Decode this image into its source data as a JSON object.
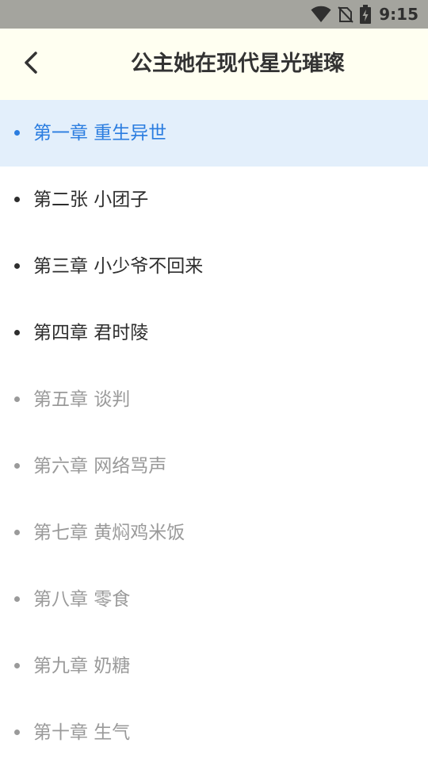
{
  "status_bar": {
    "time": "9:15",
    "icons": [
      "wifi-icon",
      "no-sim-icon",
      "battery-charging-icon"
    ]
  },
  "header": {
    "back_icon": "chevron-left-icon",
    "title": "公主她在现代星光璀璨"
  },
  "colors": {
    "active": "#2b7de0",
    "read": "#2e2e2e",
    "locked": "#9a9a9a",
    "active_bg": "#e3effb",
    "header_bg": "#fffff1"
  },
  "chapters": [
    {
      "label": "第一章 重生异世",
      "state": "active"
    },
    {
      "label": "第二张 小团子",
      "state": "read"
    },
    {
      "label": "第三章 小少爷不回来",
      "state": "read"
    },
    {
      "label": "第四章 君时陵",
      "state": "read"
    },
    {
      "label": "第五章 谈判",
      "state": "locked"
    },
    {
      "label": "第六章 网络骂声",
      "state": "locked"
    },
    {
      "label": "第七章 黄焖鸡米饭",
      "state": "locked"
    },
    {
      "label": "第八章 零食",
      "state": "locked"
    },
    {
      "label": "第九章 奶糖",
      "state": "locked"
    },
    {
      "label": "第十章 生气",
      "state": "locked"
    }
  ]
}
